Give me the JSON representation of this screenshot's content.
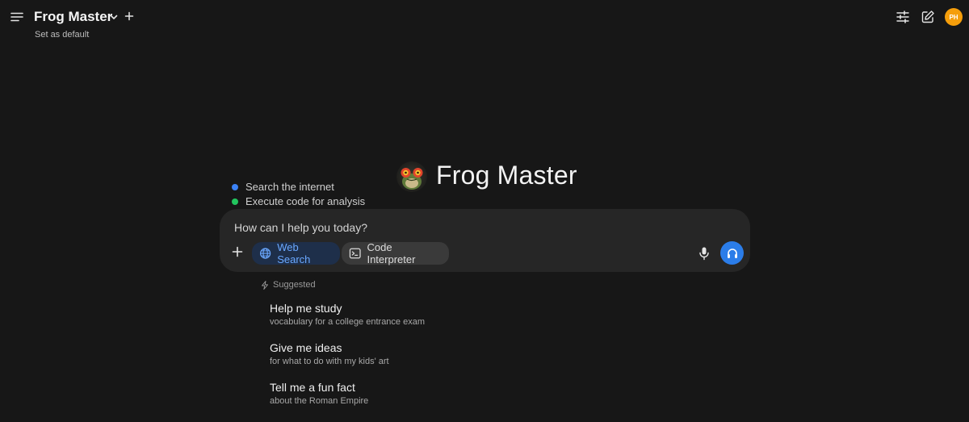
{
  "header": {
    "model_name": "Frog Master",
    "set_default_label": "Set as default",
    "user_initials": "PH"
  },
  "hero": {
    "title": "Frog Master"
  },
  "tools_active": [
    {
      "label": "Search the internet",
      "color": "#3b82f6"
    },
    {
      "label": "Execute code for analysis",
      "color": "#22c55e"
    }
  ],
  "input": {
    "placeholder": "How can I help you today?",
    "value": ""
  },
  "toolbar": {
    "web_search_label": "Web Search",
    "code_interpreter_label": "Code Interpreter"
  },
  "suggested": {
    "header": "Suggested",
    "items": [
      {
        "title": "Help me study",
        "subtitle": "vocabulary for a college entrance exam"
      },
      {
        "title": "Give me ideas",
        "subtitle": "for what to do with my kids' art"
      },
      {
        "title": "Tell me a fun fact",
        "subtitle": "about the Roman Empire"
      }
    ]
  },
  "colors": {
    "background": "#171717",
    "input_bg": "#262626",
    "accent_blue": "#2b7de9",
    "web_search_text": "#6aa8ff",
    "avatar": "#f59e0b"
  },
  "icons": [
    "menu-icon",
    "chevron-down-icon",
    "plus-icon",
    "sliders-icon",
    "pencil-square-icon",
    "globe-icon",
    "terminal-icon",
    "microphone-icon",
    "headphones-icon",
    "bolt-icon"
  ]
}
